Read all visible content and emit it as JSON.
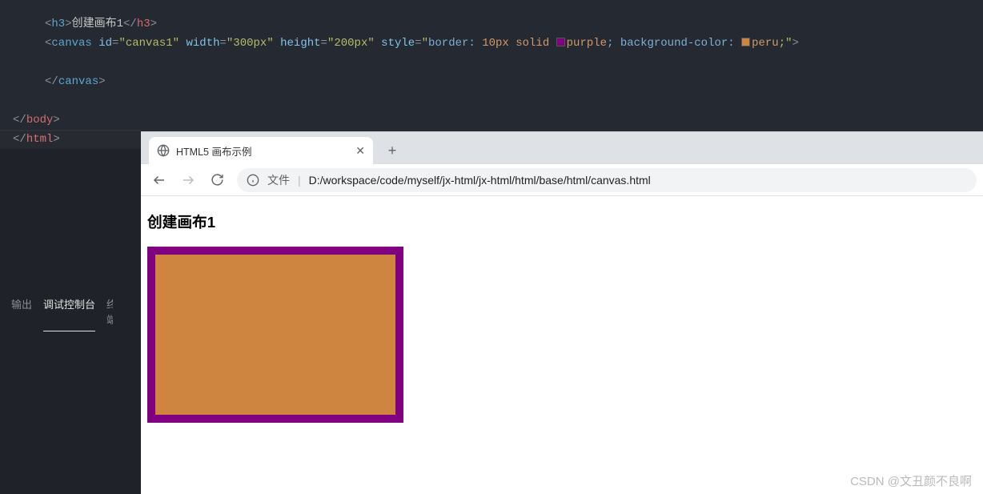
{
  "code": {
    "line1": {
      "tag": "h3",
      "text": "创建画布1"
    },
    "line2": {
      "tag": "canvas",
      "attrs": {
        "id": "\"canvas1\"",
        "width": "\"300px\"",
        "height": "\"200px\"",
        "style_open": "\"",
        "border_prop": "border:",
        "border_val": "10px solid ",
        "border_color": "purple",
        "bg_prop": "; background-color: ",
        "bg_color": "peru",
        "style_close": ";\""
      }
    },
    "line3": {
      "close": "canvas"
    },
    "line4": {
      "close": "body"
    },
    "line5": {
      "close": "html"
    }
  },
  "panel": {
    "tabs": [
      {
        "label": "输出",
        "active": false
      },
      {
        "label": "调试控制台",
        "active": true
      },
      {
        "label": "终端",
        "active": false
      }
    ]
  },
  "browser": {
    "tab_title": "HTML5 画布示例",
    "address_prefix": "文件",
    "address_path": "D:/workspace/code/myself/jx-html/jx-html/html/base/html/canvas.html"
  },
  "page": {
    "heading": "创建画布1"
  },
  "watermark": "CSDN @文丑颜不良啊"
}
